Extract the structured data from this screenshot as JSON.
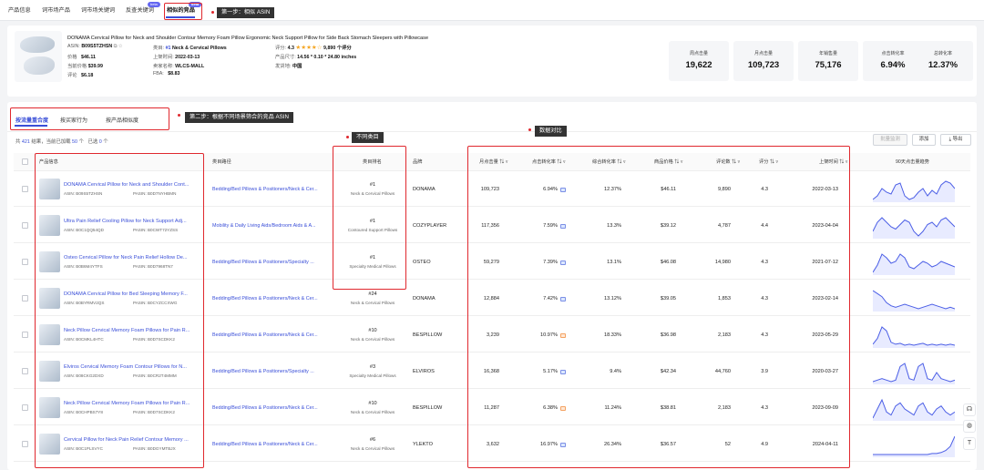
{
  "nav_tabs": [
    {
      "label": "产品信息"
    },
    {
      "label": "词市场产品"
    },
    {
      "label": "词市场关键词"
    },
    {
      "label": "反查关键词",
      "badge": "beta"
    },
    {
      "label": "相似的竞品",
      "badge": "beta",
      "active": true
    }
  ],
  "callouts": {
    "step1": "第一步：相似 ASIN",
    "step2": "第二步：根据不同场景筛合的竞品 ASIN",
    "diff_category": "不同类目",
    "data_compare": "数据对比"
  },
  "product": {
    "title": "DONAMA Cervical Pillow for Neck and Shoulder Contour Memory Foam Pillow Ergonomic Neck Support Pillow for Side Back Stomach Sleepers with Pillowcase",
    "asin_label": "ASIN:",
    "asin": "B09S5TZHSN",
    "category_label": "类目:",
    "category_rank": "#1",
    "category": "Neck & Cervical Pillows",
    "rating_label": "评分:",
    "rating": "4.3",
    "stars": "★★★★☆",
    "review_count": "9,890 个评分",
    "price_label": "价格",
    "price": "$46.11",
    "launch_label": "上架时间:",
    "launch": "2022-03-13",
    "size_label": "产品尺寸:",
    "size": "14.56 * 0.10 * 24.80 inches",
    "lowest_label": "当前价格",
    "lowest": "$39.99",
    "seller_label": "卖家名称:",
    "seller": "WLCS-MALL",
    "ship_label": "发货地:",
    "ship": "中国",
    "rating2_label": "评论",
    "rating2": "$6.18",
    "fba_label": "FBA:",
    "fba": "$8.83"
  },
  "stats": [
    {
      "label": "周点击量",
      "value": "19,622"
    },
    {
      "label": "月点击量",
      "value": "109,723"
    },
    {
      "label": "年销售量",
      "value": "75,176"
    },
    {
      "label": "点击转化率",
      "value": "6.94%"
    },
    {
      "label": "总转化率",
      "value": "12.37%"
    }
  ],
  "subtabs": [
    {
      "label": "按流量重合度",
      "active": true
    },
    {
      "label": "按买家行为"
    },
    {
      "label": "按产品相似度"
    }
  ],
  "summary": {
    "prefix": "共",
    "count": "421",
    "mid": "结果，当前已加载",
    "loaded": "50",
    "suffix": "个",
    "selected_label": "已选",
    "selected": "0",
    "unit": "个"
  },
  "buttons": {
    "batch": "批量监测",
    "favorite": "添加",
    "export": "导出"
  },
  "columns": {
    "product": "产品信息",
    "category_path": "类目路径",
    "category_rank": "类目排名",
    "brand": "品牌",
    "clicks": "月点击量",
    "click_conv": "点击转化率",
    "total_conv": "综合转化率",
    "price": "商品价格",
    "reviews": "评论数",
    "rating": "评分",
    "launch": "上架时间",
    "trend": "90天点击量趋势"
  },
  "rows": [
    {
      "name": "DONAMA Cervical Pillow for Neck and Shoulder Cont...",
      "asin": "ASIN: B09S5TZHSN",
      "pasin": "PASIN: B0D7NYHBMN",
      "category": "Bedding/Bed Pillows & Positioners/Neck & Cer...",
      "rank": "#1",
      "rank_cat": "Neck & Cervical Pillows",
      "brand": "DONAMA",
      "clicks": "109,723",
      "click_conv": "6.94%",
      "total_conv": "12.37%",
      "price": "$46.11",
      "reviews": "9,890",
      "rating": "4.3",
      "launch": "2022-03-13",
      "trend": [
        12,
        14,
        18,
        16,
        15,
        20,
        21,
        14,
        12,
        13,
        16,
        18,
        14,
        17,
        15,
        20,
        22,
        21,
        18
      ]
    },
    {
      "name": "Ultra Pain Relief Cooling Pillow for Neck Support Adj...",
      "asin": "ASIN: B0C1QQ54QD",
      "pasin": "PASIN: B0CWT72YZSS",
      "category": "Mobility & Daily Living Aids/Bedroom Aids & A...",
      "rank": "#1",
      "rank_cat": "Contoured Support Pillows",
      "brand": "COZYPLAYER",
      "clicks": "117,356",
      "click_conv": "7.59%",
      "total_conv": "13.3%",
      "price": "$39.12",
      "reviews": "4,787",
      "rating": "4.4",
      "launch": "2023-04-04",
      "trend": [
        14,
        18,
        20,
        18,
        16,
        15,
        17,
        19,
        18,
        14,
        12,
        14,
        17,
        18,
        16,
        19,
        20,
        18,
        16
      ]
    },
    {
      "name": "Osteo Cervical Pillow for Neck Pain Relief Hollow De...",
      "asin": "ASIN: B0B6M4YTFS",
      "pasin": "PASIN: B0D7968TN7",
      "category": "Bedding/Bed Pillows & Positioners/Specialty ...",
      "rank": "#1",
      "rank_cat": "Specialty Medical Pillows",
      "brand": "OSTEO",
      "clicks": "59,279",
      "click_conv": "7.39%",
      "total_conv": "13.1%",
      "price": "$46.08",
      "reviews": "14,980",
      "rating": "4.3",
      "launch": "2021-07-12",
      "trend": [
        10,
        14,
        20,
        18,
        15,
        16,
        20,
        18,
        13,
        12,
        14,
        16,
        15,
        13,
        14,
        16,
        15,
        14,
        13
      ]
    },
    {
      "name": "DONAMA Cervical Pillow for Bed Sleeping Memory F...",
      "asin": "ASIN: B0BYRMV2QS",
      "pasin": "PASIN: B0CYZCCXWG",
      "category": "Bedding/Bed Pillows & Positioners/Neck & Cer...",
      "rank": "#24",
      "rank_cat": "Neck & Cervical Pillows",
      "brand": "DONAMA",
      "clicks": "12,884",
      "click_conv": "7.42%",
      "total_conv": "13.12%",
      "price": "$39.05",
      "reviews": "1,853",
      "rating": "4.3",
      "launch": "2023-02-14",
      "trend": [
        20,
        18,
        16,
        12,
        10,
        9,
        10,
        11,
        10,
        9,
        8,
        9,
        10,
        11,
        10,
        9,
        8,
        9,
        8
      ]
    },
    {
      "name": "Neck Pillow Cervical Memory Foam Pillows for Pain R...",
      "asin": "ASIN: B0CMKL4HTC",
      "pasin": "PASIN: B0D7SCDKK2",
      "category": "Bedding/Bed Pillows & Positioners/Neck & Cer...",
      "rank": "#10",
      "rank_cat": "Neck & Cervical Pillows",
      "brand": "BESPILLOW",
      "clicks": "3,239",
      "click_conv": "10.97%",
      "total_conv": "18.33%",
      "price": "$36.98",
      "reviews": "2,183",
      "rating": "4.3",
      "launch": "2023-05-29",
      "trend": [
        6,
        12,
        24,
        20,
        8,
        6,
        7,
        5,
        6,
        5,
        6,
        7,
        5,
        6,
        5,
        6,
        5,
        6,
        5
      ]
    },
    {
      "name": "Elviros Cervical Memory Foam Contour Pillows for N...",
      "asin": "ASIN: B08CKG2DXD",
      "pasin": "PASIN: B0CR2T4MMM",
      "category": "Bedding/Bed Pillows & Positioners/Specialty ...",
      "rank": "#3",
      "rank_cat": "Specialty Medical Pillows",
      "brand": "ELVIROS",
      "clicks": "16,368",
      "click_conv": "5.17%",
      "total_conv": "9.4%",
      "price": "$42.34",
      "reviews": "44,760",
      "rating": "3.9",
      "launch": "2020-03-27",
      "trend": [
        8,
        9,
        10,
        9,
        8,
        9,
        18,
        20,
        10,
        9,
        18,
        20,
        10,
        9,
        14,
        10,
        9,
        8,
        9
      ]
    },
    {
      "name": "Neck Pillow Cervical Memory Foam Pillows for Pain R...",
      "asin": "ASIN: B0CHPBS7Y8",
      "pasin": "PASIN: B0D7SCDKK2",
      "category": "Bedding/Bed Pillows & Positioners/Neck & Cer...",
      "rank": "#10",
      "rank_cat": "Neck & Cervical Pillows",
      "brand": "BESPILLOW",
      "clicks": "11,287",
      "click_conv": "6.38%",
      "total_conv": "11.24%",
      "price": "$38.81",
      "reviews": "2,183",
      "rating": "4.3",
      "launch": "2023-09-09",
      "trend": [
        8,
        14,
        20,
        12,
        10,
        16,
        18,
        14,
        12,
        10,
        16,
        18,
        12,
        10,
        14,
        16,
        12,
        10,
        12
      ]
    },
    {
      "name": "Cervical Pillow for Neck Pain Relief Contour Memory ...",
      "asin": "ASIN: B0C1PLSVYC",
      "pasin": "PASIN: B0DGYMTBJX",
      "category": "Bedding/Bed Pillows & Positioners/Neck & Cer...",
      "rank": "#6",
      "rank_cat": "Neck & Cervical Pillows",
      "brand": "YLEKTO",
      "clicks": "3,632",
      "click_conv": "16.97%",
      "total_conv": "26.34%",
      "price": "$36.57",
      "reviews": "52",
      "rating": "4.9",
      "launch": "2024-04-11",
      "trend": [
        2,
        2,
        2,
        2,
        2,
        2,
        2,
        2,
        2,
        2,
        2,
        2,
        2,
        3,
        3,
        4,
        6,
        10,
        20
      ]
    }
  ],
  "side_icons": [
    "headset-icon",
    "globe-icon",
    "text-icon"
  ]
}
